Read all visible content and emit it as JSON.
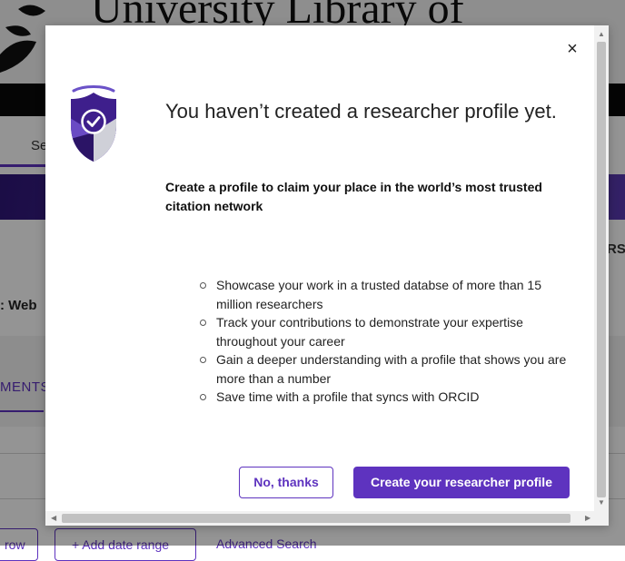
{
  "background": {
    "site_title": "University Library of",
    "tab_search": "Sea",
    "right_label": "RS",
    "web_label": ": Web",
    "tab_partial": "MENTS",
    "btn_row_partial": "row",
    "btn_add_date": "+ Add date range",
    "link_advanced": "Advanced Search"
  },
  "dialog": {
    "close_label": "×",
    "icon": "shield-check-icon",
    "heading": "You haven’t created a researcher profile yet.",
    "subheading": "Create a profile to claim your place in the world’s most trusted citation network",
    "benefits": [
      "Showcase your work in a trusted databse of more than 15 million researchers",
      "Track your contributions to demonstrate your expertise throughout your career",
      "Gain a deeper understanding with a profile that shows you are more than a number",
      "Save time with a profile that syncs with ORCID"
    ],
    "secondary_button": "No, thanks",
    "primary_button": "Create your researcher profile"
  },
  "colors": {
    "accent": "#5e33bf",
    "overlay": "rgba(0,0,0,0.42)"
  }
}
